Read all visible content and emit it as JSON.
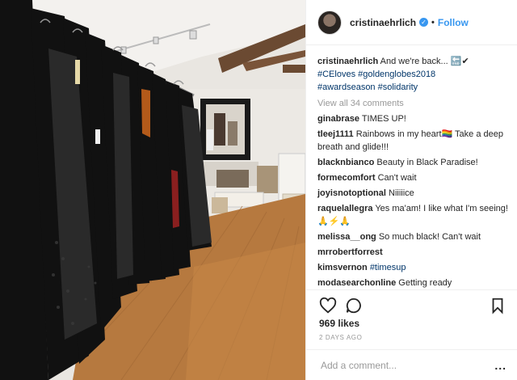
{
  "header": {
    "username": "cristinaehrlich",
    "verified_icon": "verified-badge-icon",
    "separator": "•",
    "follow_label": "Follow"
  },
  "caption": {
    "username": "cristinaehrlich",
    "text": "And we're back... ",
    "emoji": "🔚✔",
    "hashtags": [
      "#CEloves",
      "#goldenglobes2018",
      "#awardseason",
      "#solidarity"
    ]
  },
  "view_all_comments": "View all 34 comments",
  "comments": [
    {
      "user": "ginabrase",
      "text": "TIMES UP!"
    },
    {
      "user": "tleej1111",
      "text": "Rainbows in my heart🏳‍🌈 Take a deep breath and glide!!!"
    },
    {
      "user": "blacknbianco",
      "text": "Beauty in Black Paradise!"
    },
    {
      "user": "formecomfort",
      "text": "Can't wait"
    },
    {
      "user": "joyisnotoptional",
      "text": "Niiiiice"
    },
    {
      "user": "raquelallegra",
      "text": "Yes ma'am! I like what I'm seeing! 🙏⚡🙏"
    },
    {
      "user": "melissa__ong",
      "text": "So much black! Can't wait"
    },
    {
      "user": "mrrobertforrest",
      "text": ""
    },
    {
      "user": "kimsvernon",
      "text": "#timesup"
    },
    {
      "user": "modasearchonline",
      "text": "Getting ready"
    }
  ],
  "actions": {
    "like_icon": "heart-icon",
    "comment_icon": "comment-icon",
    "save_icon": "bookmark-icon"
  },
  "likes": "969 likes",
  "timestamp": "2 DAYS AGO",
  "add_comment": {
    "placeholder": "Add a comment...",
    "more_label": "..."
  },
  "colors": {
    "accent": "#3897f0",
    "hashtag": "#003569",
    "muted": "#999999",
    "border": "#efefef"
  }
}
